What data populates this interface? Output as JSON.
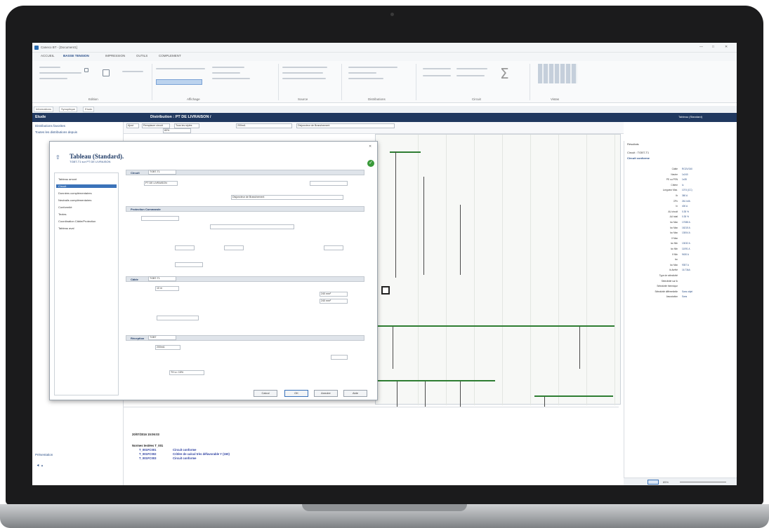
{
  "app": {
    "title": "Caneco BT - [Document1]",
    "menu_tabs": [
      "ACCUEIL",
      "BASSE TENSION",
      "IMPRESSION",
      "OUTILS",
      "COMPLEMENT"
    ],
    "ribbon_groups": [
      "Edition",
      "Affichage",
      "Source",
      "Distributions",
      "Circuit",
      "Vistas"
    ],
    "view_tabs": [
      "Informations",
      "Synoptique",
      "Etude"
    ]
  },
  "nav": {
    "left_title": "Etude",
    "center_title": "Distribution : PT DE LIVRAISON /",
    "right_info": "Tableau (Standard)"
  },
  "left_panel": {
    "items": [
      "Distributions favorites",
      "Toutes les distributions depuis"
    ],
    "bottom_label": "Présentation"
  },
  "toolbar": {
    "add_label": "Ajout",
    "replace_label": "Remplacer circuit",
    "filter_label": "Tous les styles",
    "value_label": "200mA",
    "designation": "Disjoncteur de Branchement",
    "zoom": "80%"
  },
  "dialog": {
    "title": "Tableau (Standard).",
    "subtitle": "TGBT-T1 sur PT DE LIVRAISON",
    "tree_items": [
      "Tableau amont",
      "Circuit",
      "Données complémentaires",
      "Neutralis complémentaires",
      "Conformité",
      "Textes",
      "Coordination Câble/Protection",
      "Tableau aval"
    ],
    "sections": {
      "circuit": "Circuit",
      "protection": "Protection Commande",
      "cable": "Câble",
      "reception": "Réception"
    },
    "fields": {
      "circuit_name": "TGBT-T1",
      "amont": "PT DE LIVRAISON",
      "designation": "Disjoncteur de Branchement",
      "cable_name": "TGBT-T1",
      "longueur": "10 m",
      "conducteur": "240 mm²",
      "reception_name": "TGBT",
      "courant": "200mA",
      "harmoniques": "TH ≤= 15%"
    },
    "buttons": {
      "calcul": "Calcul",
      "ok": "OK",
      "annuler": "Annuler",
      "aide": "Aide"
    }
  },
  "right_panel": {
    "header": "Résultats",
    "circuit": "Circuit : TGBT-T1",
    "conformity": "Circuit conforme",
    "rows": [
      {
        "k": "Câble",
        "v": "RO2V/240"
      },
      {
        "k": "Neutre",
        "v": "1x240"
      },
      {
        "k": "PE ou PEN",
        "v": "1x35"
      },
      {
        "k": "Critère",
        "v": "Ic"
      },
      {
        "k": "Longueur Max.",
        "v": "1074 (CC)"
      },
      {
        "k": "Ib",
        "v": "360 A"
      },
      {
        "k": "ΣPn",
        "v": "261 kVA"
      },
      {
        "k": "In",
        "v": "400 A"
      },
      {
        "k": "ΔU circuit",
        "v": "0.35 %"
      },
      {
        "k": "ΔU total",
        "v": "0.35 %"
      },
      {
        "k": "Icc Max",
        "v": "17088 A"
      },
      {
        "k": "Icc Max",
        "v": "16215 A"
      },
      {
        "k": "Icc Max",
        "v": "13004 A"
      },
      {
        "k": "If Max",
        "v": ""
      },
      {
        "k": "Icc Min",
        "v": "13032 A"
      },
      {
        "k": "Icc Min",
        "v": "11091 A"
      },
      {
        "k": "If Min",
        "v": "9430 A"
      },
      {
        "k": "Icc",
        "v": ""
      },
      {
        "k": "Icc Max",
        "v": "9357 A"
      },
      {
        "k": "Ik Arrêté",
        "v": "16.73kA"
      },
      {
        "k": "Type de sélectivité",
        "v": ""
      },
      {
        "k": "Sélectivité sur Ik",
        "v": ""
      },
      {
        "k": "Sélectivité thermique",
        "v": ""
      },
      {
        "k": "Sélectivité différentielle",
        "v": "Sans objet"
      },
      {
        "k": "Association",
        "v": "Sans"
      }
    ]
  },
  "log": {
    "timestamp": "20/07/2016 15:06:03",
    "heading": "Normes testées T_001",
    "lines": [
      {
        "id": "T_001FC001",
        "msg": "Circuit conforme"
      },
      {
        "id": "T_001FC002",
        "msg": "Critère de calcul très défavorable Y (150)"
      },
      {
        "id": "T_001FC003",
        "msg": "Circuit conforme"
      }
    ]
  },
  "status": {
    "zoom": "85%"
  }
}
